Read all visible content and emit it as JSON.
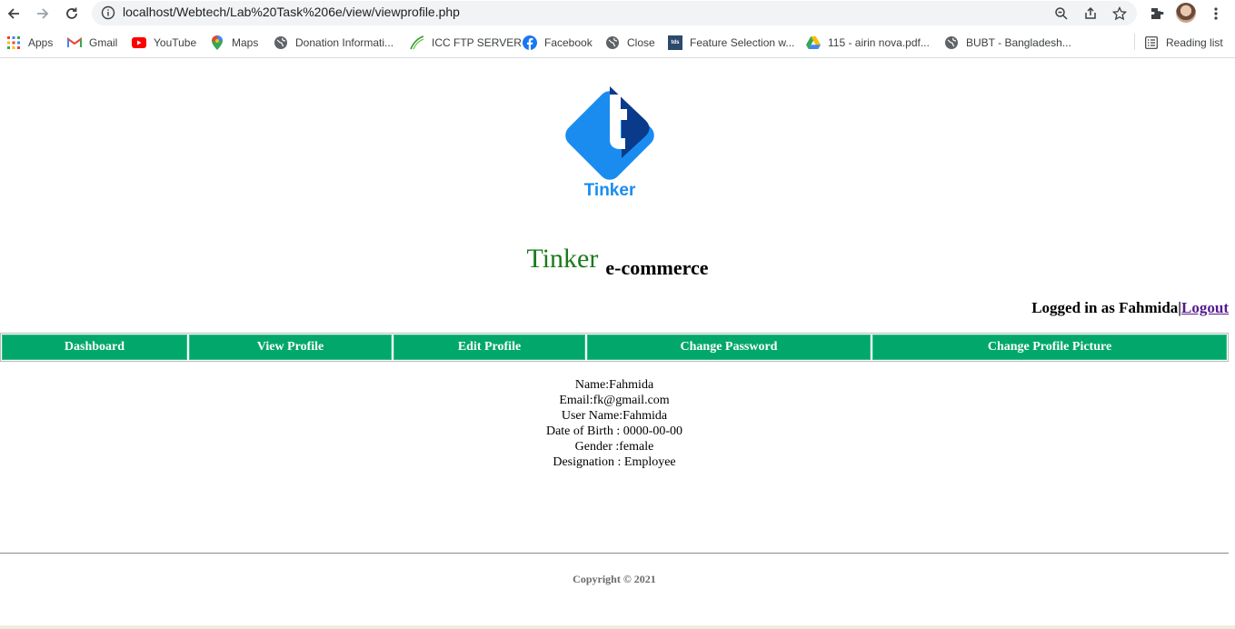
{
  "browser": {
    "url": "localhost/Webtech/Lab%20Task%206e/view/viewprofile.php",
    "bookmarks": [
      {
        "label": "Apps",
        "icon": "apps-grid-icon"
      },
      {
        "label": "Gmail",
        "icon": "gmail-icon"
      },
      {
        "label": "YouTube",
        "icon": "youtube-icon"
      },
      {
        "label": "Maps",
        "icon": "maps-pin-icon"
      },
      {
        "label": "Donation Informati...",
        "icon": "globe-icon"
      },
      {
        "label": "ICC FTP SERVER",
        "icon": "icc-icon"
      },
      {
        "label": "Facebook",
        "icon": "facebook-icon"
      },
      {
        "label": "Close",
        "icon": "globe-icon"
      },
      {
        "label": "Feature Selection w...",
        "icon": "tds-icon"
      },
      {
        "label": "115 - airin nova.pdf...",
        "icon": "drive-icon"
      },
      {
        "label": "BUBT - Bangladesh...",
        "icon": "globe-icon"
      }
    ],
    "reading_list": "Reading list",
    "tds_text": "tds"
  },
  "page": {
    "logo_text": "Tinker",
    "brand_name": "Tinker",
    "brand_sub": "e-commerce",
    "login_text": "Logged in as Fahmida",
    "login_separator": "|",
    "logout": "Logout",
    "menu": [
      "Dashboard",
      "View Profile",
      "Edit Profile",
      "Change Password",
      "Change Profile Picture"
    ],
    "profile": {
      "name": "Name:Fahmida",
      "email": "Email:fk@gmail.com",
      "username": "User Name:Fahmida",
      "dob": "Date of Birth : 0000-00-00",
      "gender": "Gender :female",
      "designation": "Designation : Employee"
    },
    "copyright": "Copyright © 2021"
  },
  "colors": {
    "menu_bg": "#02a86b",
    "brand_green": "#1a7a1a",
    "logo_light_blue": "#1a8cf0",
    "logo_dark_blue": "#0a3a8a"
  }
}
